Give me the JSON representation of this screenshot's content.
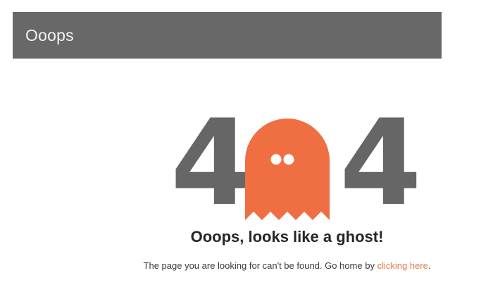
{
  "header": {
    "title": "Ooops"
  },
  "hero": {
    "digit_left": "4",
    "digit_right": "4",
    "ghost_icon": "ghost-icon",
    "ghost_color": "#ef6f42",
    "digit_color": "#666666"
  },
  "content": {
    "headline": "Ooops, looks like a ghost!",
    "message_prefix": "The page you are looking for can't be found. Go home by ",
    "link_label": "clicking here",
    "message_suffix": ".",
    "link_color": "#e8774a"
  }
}
